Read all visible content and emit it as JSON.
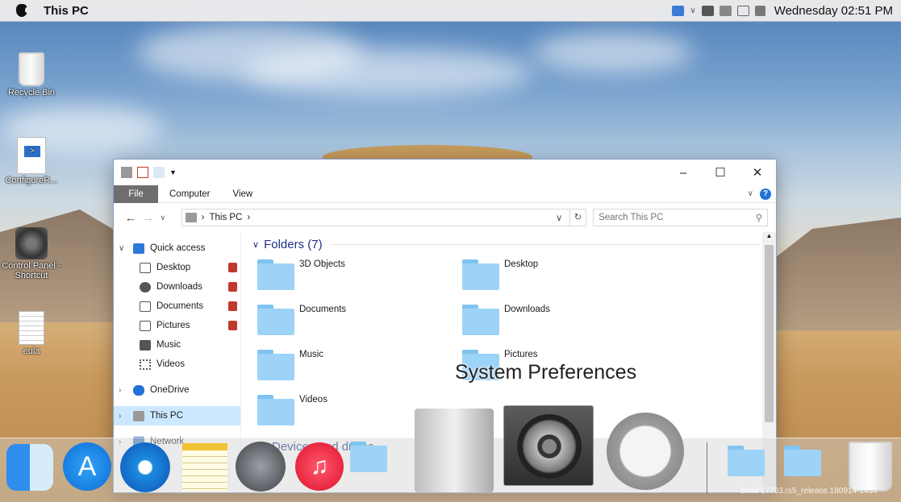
{
  "menubar": {
    "title": "This PC",
    "clock": "Wednesday 02:51 PM"
  },
  "desktop_icons": [
    {
      "label": "Recycle Bin",
      "icon": "recycle-bin-icon"
    },
    {
      "label": "ConfigureR...",
      "icon": "powershell-script-icon"
    },
    {
      "label": "Control Panel - Shortcut",
      "icon": "control-panel-icon"
    },
    {
      "label": "eula",
      "icon": "text-document-icon"
    }
  ],
  "explorer": {
    "tabs": [
      "File",
      "Computer",
      "View"
    ],
    "address": {
      "location": "This PC"
    },
    "search": {
      "placeholder": "Search This PC"
    },
    "nav": {
      "quick_access": "Quick access",
      "items": [
        "Desktop",
        "Downloads",
        "Documents",
        "Pictures",
        "Music",
        "Videos"
      ],
      "onedrive": "OneDrive",
      "this_pc": "This PC",
      "network": "Network"
    },
    "group": {
      "label": "Folders (7)"
    },
    "folders": [
      "3D Objects",
      "Desktop",
      "Documents",
      "Downloads",
      "Music",
      "Pictures",
      "Videos"
    ],
    "next_group": "Devices and drives"
  },
  "overlay": {
    "label": "System Preferences"
  },
  "dock": {
    "items": [
      "finder-icon",
      "app-store-icon",
      "safari-icon",
      "notes-icon",
      "launchpad-icon",
      "itunes-icon",
      "library-folder-icon",
      "mac-pro-icon",
      "system-preferences-icon",
      "power-icon",
      "folder-icon",
      "documents-folder-icon",
      "trash-icon"
    ]
  },
  "watermark": "Build 17763.rs5_release.180914-1434"
}
